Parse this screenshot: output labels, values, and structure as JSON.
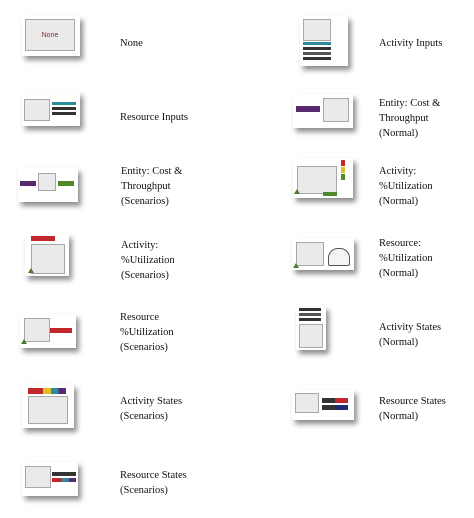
{
  "options": [
    {
      "id": "none",
      "lines": [
        "None"
      ],
      "thumb_text": "None"
    },
    {
      "id": "activity-inputs",
      "lines": [
        "Activity Inputs"
      ]
    },
    {
      "id": "resource-inputs",
      "lines": [
        "Resource Inputs"
      ]
    },
    {
      "id": "entity-cost-normal",
      "lines": [
        "Entity: Cost &",
        "Throughput",
        "(Normal)"
      ]
    },
    {
      "id": "entity-cost-scenarios",
      "lines": [
        "Entity: Cost &",
        "Throughput",
        "(Scenarios)"
      ]
    },
    {
      "id": "activity-util-normal",
      "lines": [
        "Activity:",
        "%Utilization",
        "(Normal)"
      ]
    },
    {
      "id": "activity-util-scenarios",
      "lines": [
        "Activity:",
        "%Utilization",
        "(Scenarios)"
      ]
    },
    {
      "id": "resource-util-normal",
      "lines": [
        "Resource:",
        "%Utilization",
        "(Normal)"
      ]
    },
    {
      "id": "resource-util-scenarios",
      "lines": [
        "Resource",
        "%Utilization",
        "(Scenarios)"
      ]
    },
    {
      "id": "activity-states-normal",
      "lines": [
        "Activity States",
        "(Normal)"
      ]
    },
    {
      "id": "activity-states-scenarios",
      "lines": [
        "Activity States",
        "(Scenarios)"
      ]
    },
    {
      "id": "resource-states-normal",
      "lines": [
        "Resource States",
        "(Normal)"
      ]
    },
    {
      "id": "resource-states-scenarios",
      "lines": [
        "Resource States",
        "(Scenarios)"
      ]
    }
  ],
  "colors": {
    "teal": "#2f8a9e",
    "navy": "#1f2d6e",
    "purple": "#5a2a6e",
    "red": "#c0282e",
    "green": "#4f8a2a",
    "yellow": "#e0c020"
  }
}
